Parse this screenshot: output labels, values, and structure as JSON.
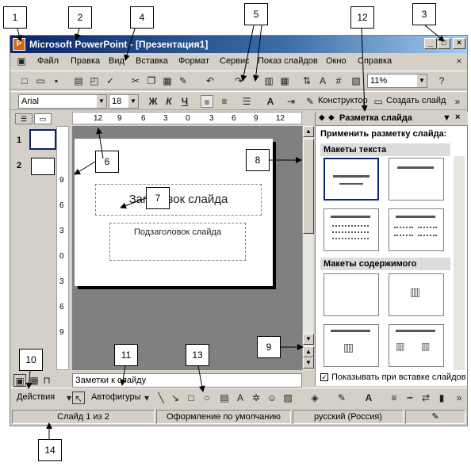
{
  "window": {
    "title": "Microsoft PowerPoint - [Презентация1]"
  },
  "menu": [
    "Файл",
    "Правка",
    "Вид",
    "Вставка",
    "Формат",
    "Сервис",
    "Показ слайдов",
    "Окно",
    "Справка"
  ],
  "toolbar": {
    "zoom": "11%",
    "font": "Arial",
    "size": "18",
    "bold": "Ж",
    "italic": "К",
    "underline": "Ч",
    "designer": "Конструктор",
    "new_slide": "Создать слайд"
  },
  "rulers": {
    "horizontal": [
      "12",
      "9",
      "6",
      "3",
      "0",
      "3",
      "6",
      "9",
      "12"
    ],
    "vertical": [
      "9",
      "6",
      "3",
      "0",
      "3",
      "6",
      "9"
    ]
  },
  "slides": [
    "1",
    "2"
  ],
  "slide": {
    "title_placeholder": "Заголовок слайда",
    "subtitle_placeholder": "Подзаголовок слайда"
  },
  "taskpane": {
    "title": "Разметка слайда",
    "apply_label": "Применить разметку слайда:",
    "group_text": "Макеты текста",
    "group_content": "Макеты содержимого",
    "show_on_insert": "Показывать при вставке слайдов"
  },
  "notes": {
    "placeholder": "Заметки к слайду"
  },
  "drawing": {
    "actions": "Действия",
    "autoshapes": "Автофигуры"
  },
  "status": {
    "slide": "Слайд 1 из 2",
    "design": "Оформление по умолчанию",
    "language": "русский (Россия)"
  },
  "callouts": [
    "1",
    "2",
    "3",
    "4",
    "5",
    "6",
    "7",
    "8",
    "9",
    "10",
    "11",
    "12",
    "13",
    "14"
  ]
}
